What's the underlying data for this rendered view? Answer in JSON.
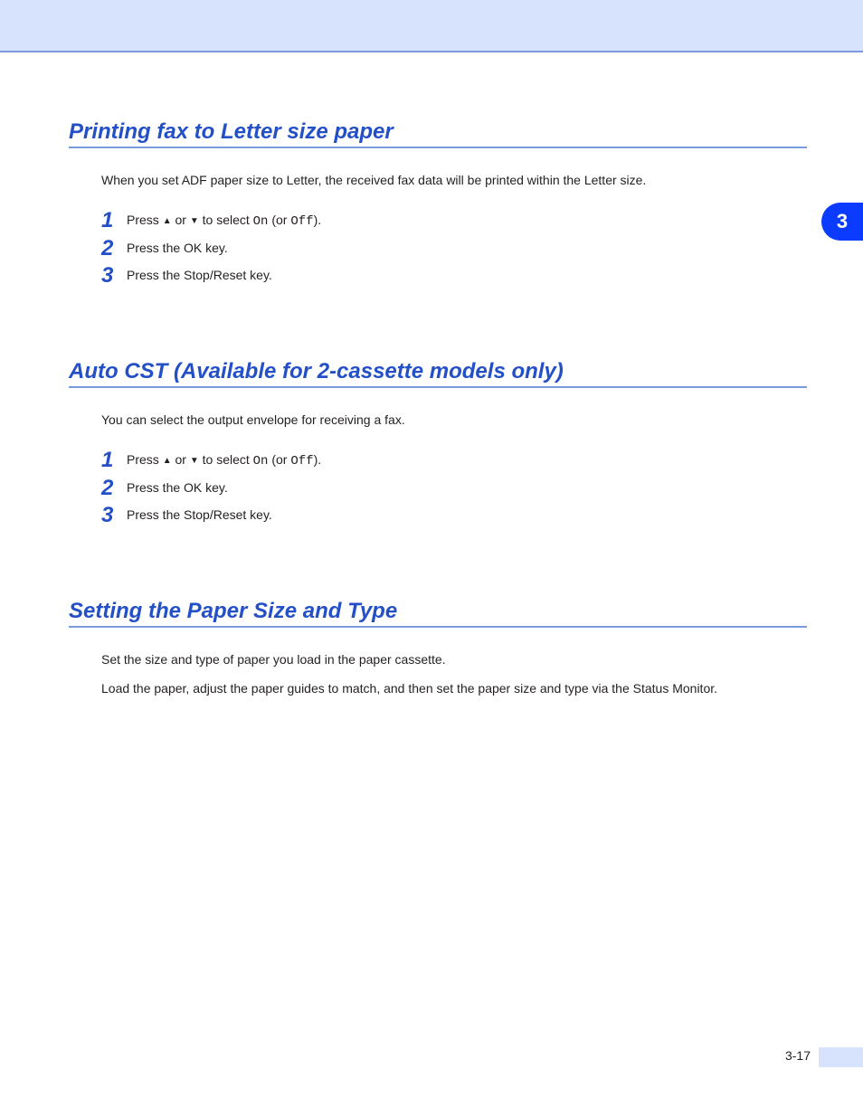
{
  "tab": {
    "number": "3"
  },
  "page": {
    "number": "3-17"
  },
  "sections": [
    {
      "title": "Printing fax to Letter size paper",
      "intro": "When you set ADF paper size to Letter, the received fax data will be printed within the Letter size.",
      "steps": [
        {
          "num": "1",
          "prefix": "Press ",
          "up": "▲",
          "or_word": " or ",
          "down": "▼",
          "select_word": " to select ",
          "on": "On",
          "slash": " (or ",
          "off": "Off",
          "paren": ")."
        },
        {
          "num": "2",
          "text": "Press the OK key."
        },
        {
          "num": "3",
          "text": "Press the Stop/Reset key."
        }
      ]
    },
    {
      "title": "Auto CST (Available for 2-cassette models only)",
      "intro": "You can select the output envelope for receiving a fax.",
      "steps": [
        {
          "num": "1",
          "prefix": "Press ",
          "up": "▲",
          "or_word": " or ",
          "down": "▼",
          "select_word": " to select ",
          "on": "On",
          "slash": " (or ",
          "off": "Off",
          "paren": ")."
        },
        {
          "num": "2",
          "text": "Press the OK key."
        },
        {
          "num": "3",
          "text": "Press the Stop/Reset key."
        }
      ]
    },
    {
      "title": "Setting the Paper Size and Type",
      "intro": "Set the size and type of paper you load in the paper cassette.",
      "body": "Load the paper,  adjust the paper guides to match, and then set the paper size and type via the Status Monitor."
    }
  ]
}
